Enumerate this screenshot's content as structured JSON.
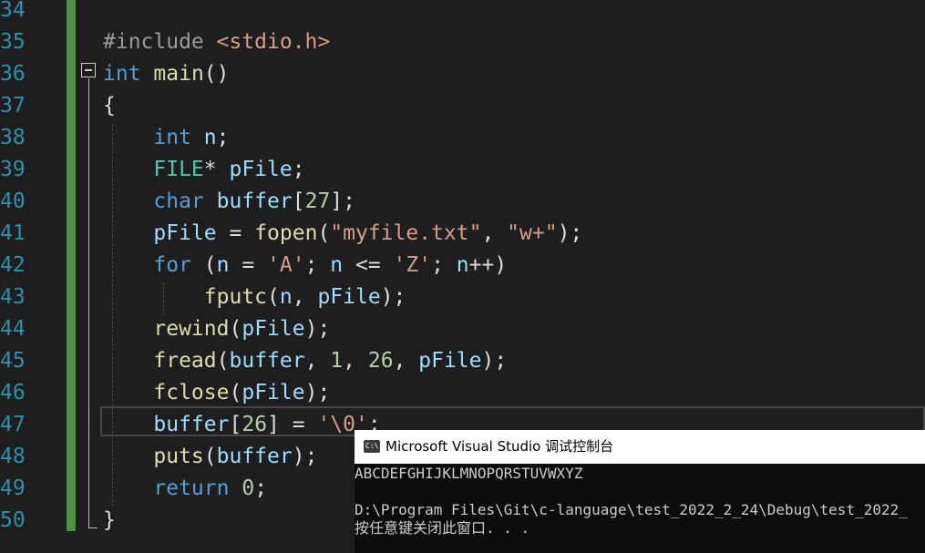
{
  "editor": {
    "line_numbers": [
      "34",
      "35",
      "36",
      "37",
      "38",
      "39",
      "40",
      "41",
      "42",
      "43",
      "44",
      "45",
      "46",
      "47",
      "48",
      "49",
      "50"
    ],
    "lines": [
      [],
      [
        {
          "t": "#include ",
          "c": "pp"
        },
        {
          "t": "<stdio.h>",
          "c": "str"
        }
      ],
      [
        {
          "t": "int",
          "c": "kw"
        },
        {
          "t": " ",
          "c": "plain"
        },
        {
          "t": "main",
          "c": "fn"
        },
        {
          "t": "()",
          "c": "plain"
        }
      ],
      [
        {
          "t": "{",
          "c": "plain"
        }
      ],
      [
        {
          "t": "    ",
          "c": "plain"
        },
        {
          "t": "int",
          "c": "kw"
        },
        {
          "t": " ",
          "c": "plain"
        },
        {
          "t": "n",
          "c": "ident"
        },
        {
          "t": ";",
          "c": "plain"
        }
      ],
      [
        {
          "t": "    ",
          "c": "plain"
        },
        {
          "t": "FILE",
          "c": "ty"
        },
        {
          "t": "* ",
          "c": "plain"
        },
        {
          "t": "pFile",
          "c": "ident"
        },
        {
          "t": ";",
          "c": "plain"
        }
      ],
      [
        {
          "t": "    ",
          "c": "plain"
        },
        {
          "t": "char",
          "c": "kw"
        },
        {
          "t": " ",
          "c": "plain"
        },
        {
          "t": "buffer",
          "c": "ident"
        },
        {
          "t": "[",
          "c": "plain"
        },
        {
          "t": "27",
          "c": "num"
        },
        {
          "t": "];",
          "c": "plain"
        }
      ],
      [
        {
          "t": "    ",
          "c": "plain"
        },
        {
          "t": "pFile",
          "c": "ident"
        },
        {
          "t": " = ",
          "c": "plain"
        },
        {
          "t": "fopen",
          "c": "fn"
        },
        {
          "t": "(",
          "c": "plain"
        },
        {
          "t": "\"myfile.txt\"",
          "c": "str"
        },
        {
          "t": ", ",
          "c": "plain"
        },
        {
          "t": "\"w+\"",
          "c": "str"
        },
        {
          "t": ");",
          "c": "plain"
        }
      ],
      [
        {
          "t": "    ",
          "c": "plain"
        },
        {
          "t": "for",
          "c": "kw"
        },
        {
          "t": " (",
          "c": "plain"
        },
        {
          "t": "n",
          "c": "ident"
        },
        {
          "t": " = ",
          "c": "plain"
        },
        {
          "t": "'A'",
          "c": "str"
        },
        {
          "t": "; ",
          "c": "plain"
        },
        {
          "t": "n",
          "c": "ident"
        },
        {
          "t": " <= ",
          "c": "plain"
        },
        {
          "t": "'Z'",
          "c": "str"
        },
        {
          "t": "; ",
          "c": "plain"
        },
        {
          "t": "n",
          "c": "ident"
        },
        {
          "t": "++)",
          "c": "plain"
        }
      ],
      [
        {
          "t": "        ",
          "c": "plain"
        },
        {
          "t": "fputc",
          "c": "fn"
        },
        {
          "t": "(",
          "c": "plain"
        },
        {
          "t": "n",
          "c": "ident"
        },
        {
          "t": ", ",
          "c": "plain"
        },
        {
          "t": "pFile",
          "c": "ident"
        },
        {
          "t": ");",
          "c": "plain"
        }
      ],
      [
        {
          "t": "    ",
          "c": "plain"
        },
        {
          "t": "rewind",
          "c": "fn"
        },
        {
          "t": "(",
          "c": "plain"
        },
        {
          "t": "pFile",
          "c": "ident"
        },
        {
          "t": ");",
          "c": "plain"
        }
      ],
      [
        {
          "t": "    ",
          "c": "plain"
        },
        {
          "t": "fread",
          "c": "fn"
        },
        {
          "t": "(",
          "c": "plain"
        },
        {
          "t": "buffer",
          "c": "ident"
        },
        {
          "t": ", ",
          "c": "plain"
        },
        {
          "t": "1",
          "c": "num"
        },
        {
          "t": ", ",
          "c": "plain"
        },
        {
          "t": "26",
          "c": "num"
        },
        {
          "t": ", ",
          "c": "plain"
        },
        {
          "t": "pFile",
          "c": "ident"
        },
        {
          "t": ");",
          "c": "plain"
        }
      ],
      [
        {
          "t": "    ",
          "c": "plain"
        },
        {
          "t": "fclose",
          "c": "fn"
        },
        {
          "t": "(",
          "c": "plain"
        },
        {
          "t": "pFile",
          "c": "ident"
        },
        {
          "t": ");",
          "c": "plain"
        }
      ],
      [
        {
          "t": "    ",
          "c": "plain"
        },
        {
          "t": "buffer",
          "c": "ident"
        },
        {
          "t": "[",
          "c": "plain"
        },
        {
          "t": "26",
          "c": "num"
        },
        {
          "t": "] = ",
          "c": "plain"
        },
        {
          "t": "'\\0'",
          "c": "str"
        },
        {
          "t": ";",
          "c": "plain"
        }
      ],
      [
        {
          "t": "    ",
          "c": "plain"
        },
        {
          "t": "puts",
          "c": "fn"
        },
        {
          "t": "(",
          "c": "plain"
        },
        {
          "t": "buffer",
          "c": "ident"
        },
        {
          "t": ");",
          "c": "plain"
        }
      ],
      [
        {
          "t": "    ",
          "c": "plain"
        },
        {
          "t": "return",
          "c": "kw"
        },
        {
          "t": " ",
          "c": "plain"
        },
        {
          "t": "0",
          "c": "num"
        },
        {
          "t": ";",
          "c": "plain"
        }
      ],
      [
        {
          "t": "}",
          "c": "plain"
        }
      ]
    ]
  },
  "console": {
    "icon_text": "C:\\",
    "title": "Microsoft Visual Studio 调试控制台",
    "output_line": "ABCDEFGHIJKLMNOPQRSTUVWXYZ",
    "path_line": "D:\\Program Files\\Git\\c-language\\test_2022_2_24\\Debug\\test_2022_",
    "prompt_line": "按任意键关闭此窗口. . ."
  },
  "colors": {
    "keyword": "#569cd6",
    "type": "#4ec9b0",
    "function": "#dcdcaa",
    "string": "#d69d85",
    "number": "#b5cea8",
    "line_number": "#2b91af",
    "change_bar": "#57a64a"
  }
}
